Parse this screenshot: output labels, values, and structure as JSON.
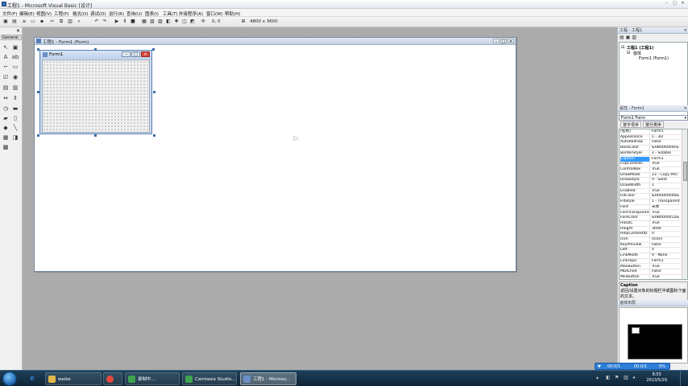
{
  "window": {
    "title": "工程1 - Microsoft Visual Basic [设计]",
    "controls": [
      "–",
      "□",
      "✕"
    ]
  },
  "menu": [
    "文件(F)",
    "编辑(E)",
    "视图(V)",
    "工程(P)",
    "格式(O)",
    "调试(D)",
    "运行(R)",
    "查询(U)",
    "图表(I)",
    "工具(T)",
    "外接程序(A)",
    "窗口(W)",
    "帮助(H)"
  ],
  "toolbar": {
    "position_readout": "0, 0",
    "size_readout": "4800 x 3600"
  },
  "toolbox": {
    "title": "General",
    "close": "✕"
  },
  "designer": {
    "title": "工程1 - Form1 (Form)"
  },
  "form1": {
    "caption": "Form1"
  },
  "project_pane": {
    "title": "工程 - 工程1",
    "close": "✕",
    "tree": [
      "工程1 (工程1)",
      "窗体",
      "Form1 (Form1)"
    ]
  },
  "properties_pane": {
    "title": "属性 - Form1",
    "close": "✕",
    "object_selector": "Form1 Form",
    "tabs": [
      "按字母序",
      "按分类序"
    ],
    "selected_property": "Caption",
    "rows": [
      {
        "name": "(名称)",
        "value": "Form1"
      },
      {
        "name": "Appearance",
        "value": "1 - 3D"
      },
      {
        "name": "AutoRedraw",
        "value": "False"
      },
      {
        "name": "BackColor",
        "value": "&H8000000F&"
      },
      {
        "name": "BorderStyle",
        "value": "2 - Sizable"
      },
      {
        "name": "Caption",
        "value": "Form1"
      },
      {
        "name": "ClipControls",
        "value": "True"
      },
      {
        "name": "ControlBox",
        "value": "True"
      },
      {
        "name": "DrawMode",
        "value": "13 - Copy Pen"
      },
      {
        "name": "DrawStyle",
        "value": "0 - Solid"
      },
      {
        "name": "DrawWidth",
        "value": "1"
      },
      {
        "name": "Enabled",
        "value": "True"
      },
      {
        "name": "FillColor",
        "value": "&H00000000&"
      },
      {
        "name": "FillStyle",
        "value": "1 - Transparent"
      },
      {
        "name": "Font",
        "value": "宋体"
      },
      {
        "name": "FontTransparent",
        "value": "True"
      },
      {
        "name": "ForeColor",
        "value": "&H80000012&"
      },
      {
        "name": "HasDC",
        "value": "True"
      },
      {
        "name": "Height",
        "value": "3600"
      },
      {
        "name": "HelpContextID",
        "value": "0"
      },
      {
        "name": "Icon",
        "value": "(Icon)"
      },
      {
        "name": "KeyPreview",
        "value": "False"
      },
      {
        "name": "Left",
        "value": "0"
      },
      {
        "name": "LinkMode",
        "value": "0 - None"
      },
      {
        "name": "LinkTopic",
        "value": "Form1"
      },
      {
        "name": "MaxButton",
        "value": "True"
      },
      {
        "name": "MDIChild",
        "value": "False"
      },
      {
        "name": "MinButton",
        "value": "True"
      }
    ],
    "description_title": "Caption",
    "description_text": "返回/设置对象的标题栏中或图标下面的文本。"
  },
  "layout_pane": {
    "title": "窗体布局"
  },
  "recording_bar": {
    "left": "00:0/1",
    "right": "00:0/1",
    "pct": "0%"
  },
  "taskbar": {
    "apps": [
      {
        "label": "weike",
        "color": "#e0b84a"
      },
      {
        "label": "",
        "color": "#e8493c"
      },
      {
        "label": "录制中...",
        "color": "#3fa34d"
      },
      {
        "label": "Camtasia Studio...",
        "color": "#3fa34d"
      },
      {
        "label": "工程1 - Microso...",
        "color": "#6b8fc4"
      }
    ],
    "time": "8:55",
    "date": "2013/5/29"
  }
}
